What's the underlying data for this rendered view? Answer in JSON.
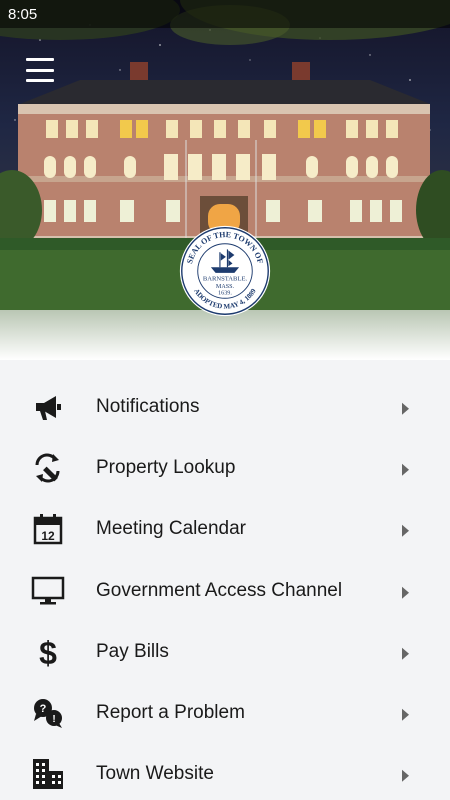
{
  "status_bar": {
    "time": "8:05"
  },
  "header": {
    "menu_icon": "hamburger-menu-icon",
    "seal": {
      "top_text": "SEAL OF THE TOWN OF",
      "center_line1": "BARNSTABLE.",
      "center_line2": "MASS.",
      "center_line3": "1639.",
      "bottom_text": "ADOPTED MAY 4, 1889"
    }
  },
  "menu": {
    "items": [
      {
        "label": "Notifications",
        "icon": "megaphone-icon"
      },
      {
        "label": "Property Lookup",
        "icon": "property-lookup-icon"
      },
      {
        "label": "Meeting Calendar",
        "icon": "calendar-icon"
      },
      {
        "label": "Government Access Channel",
        "icon": "monitor-icon"
      },
      {
        "label": "Pay Bills",
        "icon": "dollar-icon"
      },
      {
        "label": "Report a Problem",
        "icon": "report-problem-icon"
      },
      {
        "label": "Town Website",
        "icon": "buildings-icon"
      }
    ]
  },
  "colors": {
    "icon": "#1a1a1a",
    "background": "#f3f4f6",
    "chevron": "#666666",
    "seal_blue": "#1d3b6e"
  }
}
